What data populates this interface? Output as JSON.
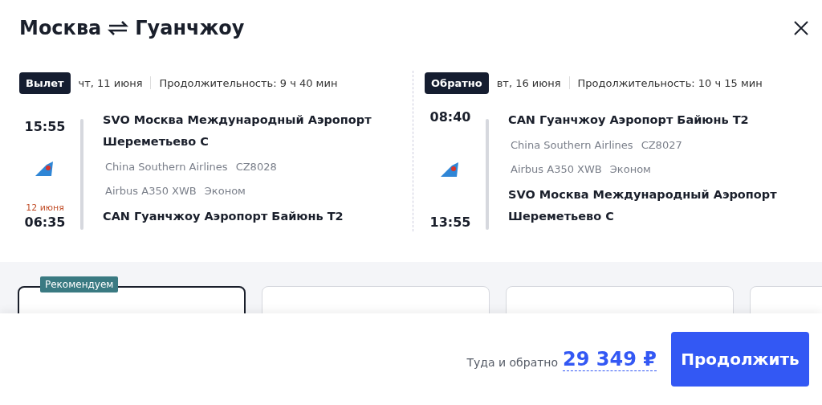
{
  "title": {
    "from": "Москва",
    "to": "Гуанчжоу"
  },
  "legs": [
    {
      "label": "Вылет",
      "date": "чт, 11 июня",
      "duration": "Продолжительность: 9 ч 40 мин",
      "departure_time": "15:55",
      "arrival_date": "12 июня",
      "arrival_time": "06:35",
      "from_airport": "SVO Москва Международный Аэропорт Шереметьево C",
      "to_airport": "CAN Гуанчжоу Аэропорт Байюнь T2",
      "airline": "China Southern Airlines",
      "flight": "CZ8028",
      "aircraft": "Airbus A350 XWB",
      "cabin": "Эконом"
    },
    {
      "label": "Обратно",
      "date": "вт, 16 июня",
      "duration": "Продолжительность: 10 ч 15 мин",
      "departure_time": "08:40",
      "arrival_time": "13:55",
      "from_airport": "CAN Гуанчжоу Аэропорт Байюнь T2",
      "to_airport": "SVO Москва Международный Аэропорт Шереметьево C",
      "airline": "China Southern Airlines",
      "flight": "CZ8027",
      "aircraft": "Airbus A350 XWB",
      "cabin": "Эконом"
    }
  ],
  "fare_cards": [
    {
      "badge": "Рекомендуем",
      "selected": true
    },
    {
      "selected": false
    },
    {
      "selected": false
    },
    {
      "selected": false
    }
  ],
  "footer": {
    "price_label": "Туда и обратно",
    "price": "29 349 ₽",
    "button": "Продолжить"
  }
}
